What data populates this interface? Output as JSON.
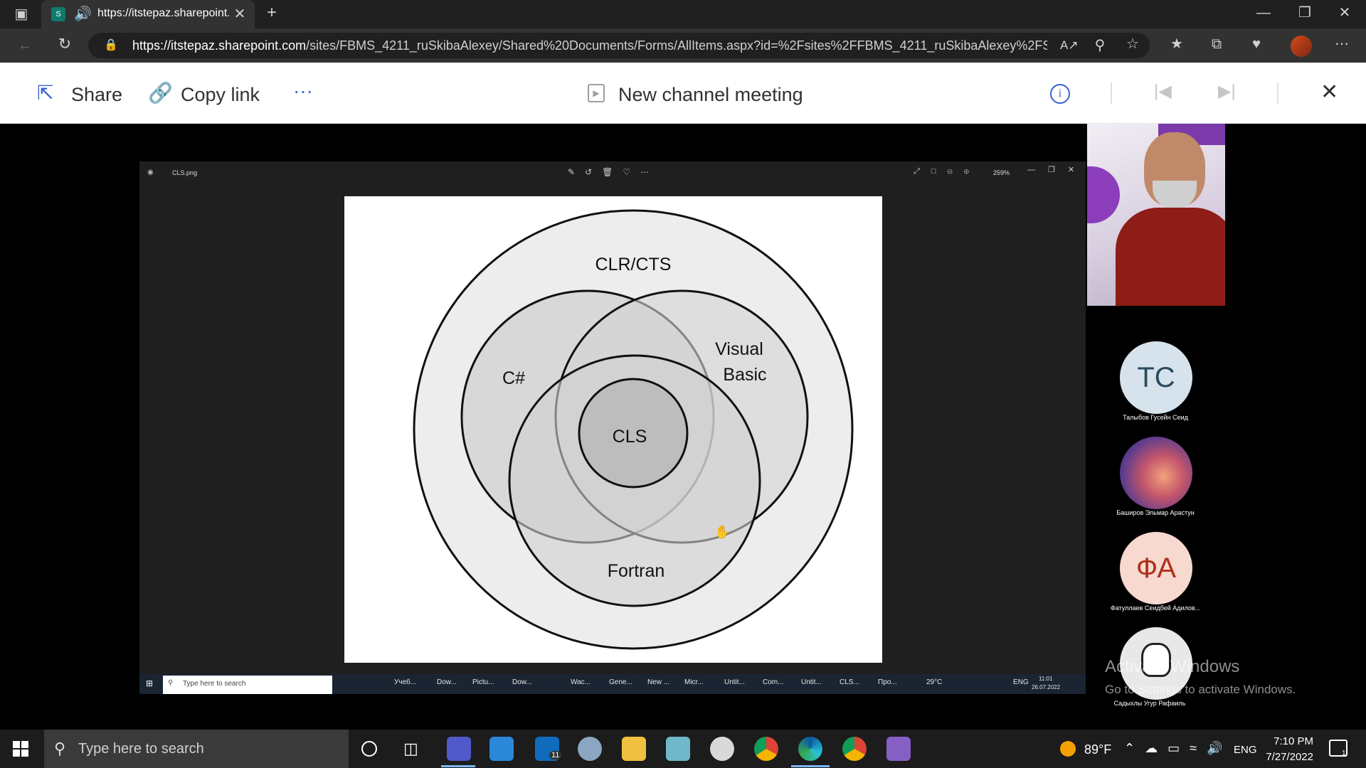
{
  "browser": {
    "tab_title": "https://itstepaz.sharepoint.c",
    "url_domain": "https://itstepaz.sharepoint.com",
    "url_path": "/sites/FBMS_4211_ruSkibaAlexey/Shared%20Documents/Forms/AllItems.aspx?id=%2Fsites%2FFBMS_4211_ruSkibaAlexey%2FShared%..."
  },
  "sharepoint": {
    "share_label": "Share",
    "copy_link_label": "Copy link",
    "more_label": "···",
    "title": "New channel meeting"
  },
  "viewer": {
    "file_name": "CLS.png",
    "zoom": "259%"
  },
  "diagram": {
    "outer": "CLR/CTS",
    "csharp": "C#",
    "vb_line1": "Visual",
    "vb_line2": "Basic",
    "cls": "CLS",
    "fortran": "Fortran"
  },
  "inner_taskbar": {
    "search_placeholder": "Type here to search",
    "apps": [
      "Учеб...",
      "Dow...",
      "Pictu...",
      "Dow...",
      "Wac...",
      "Gene...",
      "New ...",
      "Micr...",
      "Untit...",
      "Com...",
      "Untit...",
      "CLS...",
      "Про..."
    ],
    "weather": "29°C",
    "lang": "ENG",
    "time": "11:01",
    "date": "26.07.2022"
  },
  "participants": [
    {
      "initials": "TC",
      "name": "Талыбов Гусейн Сеид",
      "color": "#d6e3ec",
      "text_color": "#2b4a5e"
    },
    {
      "initials": "",
      "name": "Баширов Эльмар Арастун",
      "color": "#7a4a8a",
      "text_color": "#fff"
    },
    {
      "initials": "ФА",
      "name": "Фатуллаев Сеидбей Адилов...",
      "color": "#f7d9cf",
      "text_color": "#b0311a"
    },
    {
      "initials": "",
      "name": "Садыхлы Угур Рафаиль",
      "color": "#e8e8e8",
      "text_color": "#222"
    }
  ],
  "watermark": {
    "line1": "Activate Windows",
    "line2": "Go to Settings to activate Windows."
  },
  "taskbar": {
    "search_placeholder": "Type here to search",
    "mail_badge": "11",
    "weather": "89°F",
    "lang": "ENG",
    "time": "7:10 PM",
    "date": "7/27/2022",
    "notification_count": "1"
  }
}
